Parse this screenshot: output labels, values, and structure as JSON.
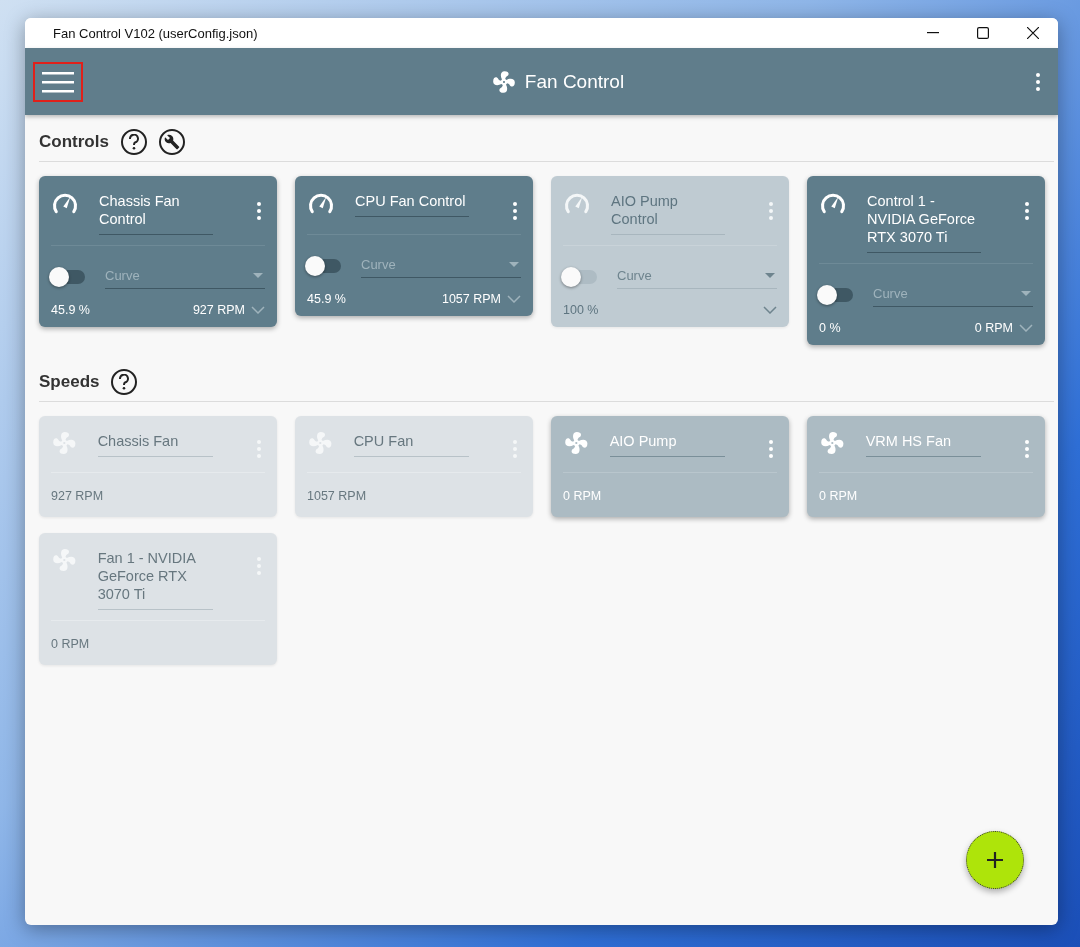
{
  "window": {
    "title": "Fan Control V102 (userConfig.json)"
  },
  "app_bar": {
    "title": "Fan Control",
    "menu_button": {
      "highlighted": true
    }
  },
  "controls": {
    "heading": "Controls",
    "cards": [
      {
        "name": "Chassis Fan Control",
        "enabled": true,
        "on": false,
        "curve_placeholder": "Curve",
        "percent": "45.9 %",
        "rpm": "927 RPM"
      },
      {
        "name": "CPU Fan Control",
        "enabled": true,
        "on": false,
        "curve_placeholder": "Curve",
        "percent": "45.9 %",
        "rpm": "1057 RPM"
      },
      {
        "name": "AIO Pump Control",
        "enabled": false,
        "on": false,
        "curve_placeholder": "Curve",
        "percent": "100 %"
      },
      {
        "name": "Control 1 - NVIDIA GeForce RTX 3070 Ti",
        "enabled": true,
        "on": false,
        "curve_placeholder": "Curve",
        "percent": "0 %",
        "rpm": "0 RPM"
      }
    ]
  },
  "speeds": {
    "heading": "Speeds",
    "cards": [
      {
        "name": "Chassis Fan",
        "faded": true,
        "rpm": "927 RPM"
      },
      {
        "name": "CPU Fan",
        "faded": true,
        "rpm": "1057 RPM"
      },
      {
        "name": "AIO Pump",
        "faded": false,
        "rpm": "0 RPM"
      },
      {
        "name": "VRM HS Fan",
        "faded": false,
        "rpm": "0 RPM"
      },
      {
        "name": "Fan 1 - NVIDIA GeForce RTX 3070 Ti",
        "faded": true,
        "rpm": "0 RPM"
      }
    ]
  }
}
